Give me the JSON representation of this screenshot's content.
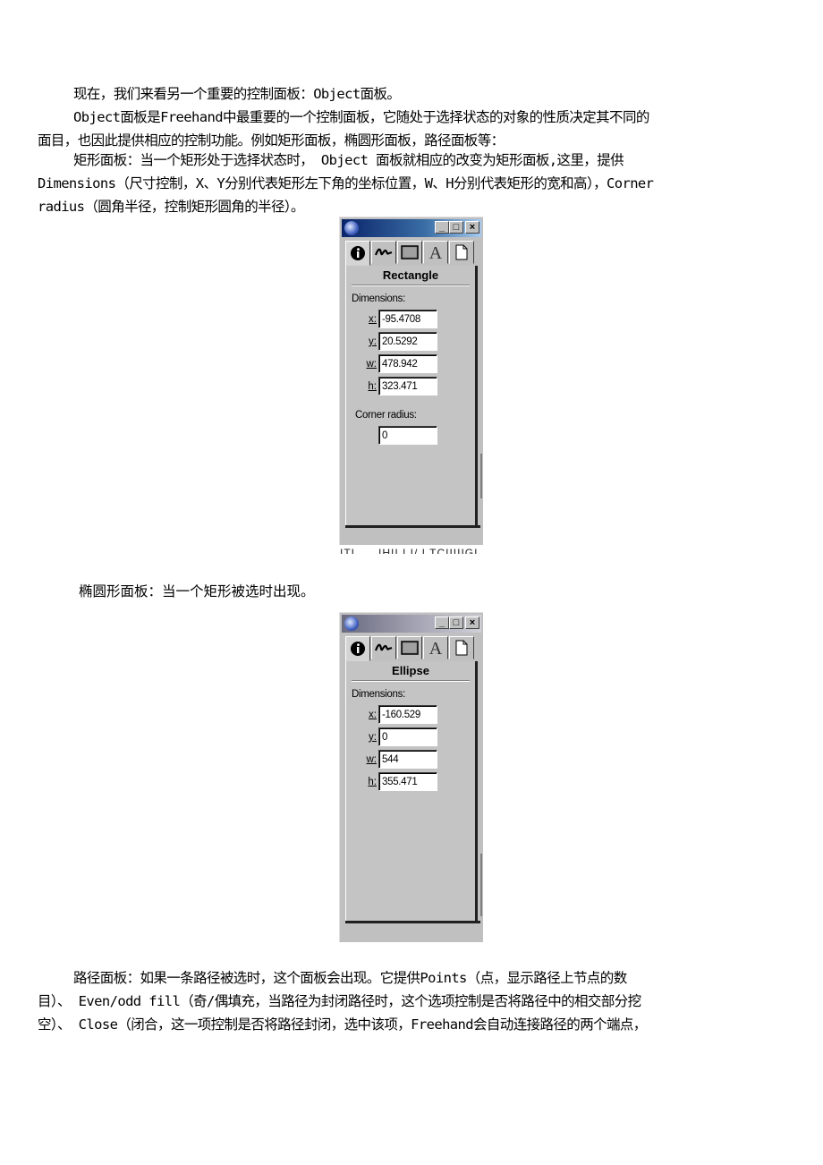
{
  "paragraphs": {
    "p1": "现在，我们来看另一个重要的控制面板：Object面板。",
    "p2_line1": "Object面板是Freehand中最重要的一个控制面板，它随处于选择状态的对象的性质决定其不同的",
    "p2_line2": "面目，也因此提供相应的控制功能。例如矩形面板，椭圆形面板，路径面板等：",
    "p3_line1": "矩形面板：当一个矩形处于选择状态时， Object 面板就相应的改变为矩形面板,这里，提供",
    "p3_line2": "Dimensions（尺寸控制，X、Y分别代表矩形左下角的坐标位置，W、H分别代表矩形的宽和高），Corner",
    "p3_line3": "radius（圆角半径，控制矩形圆角的半径）。",
    "p4": "椭圆形面板：当一个矩形被选时出现。",
    "p5_line1": "路径面板：如果一条路径被选时，这个面板会出现。它提供Points（点，显示路径上节点的数",
    "p5_line2": "目）、 Even/odd fill（奇/偶填充，当路径为封闭路径时，这个选项控制是否将路径中的相交部分挖",
    "p5_line3": "空）、 Close（闭合，这一项控制是否将路径封闭，选中该项，Freehand会自动连接路径的两个端点，"
  },
  "window_buttons": {
    "minimize": "_",
    "maximize": "□",
    "close": "×"
  },
  "tabs": [
    {
      "icon": "info-icon",
      "active": true
    },
    {
      "icon": "stroke-icon",
      "active": false
    },
    {
      "icon": "fill-icon",
      "active": false
    },
    {
      "icon": "text-icon",
      "label": "A",
      "active": false
    },
    {
      "icon": "document-icon",
      "active": false
    }
  ],
  "rectangle_panel": {
    "title": "Rectangle",
    "dimensions_label": "Dimensions:",
    "fields": [
      {
        "label": "x:",
        "value": "-95.4708"
      },
      {
        "label": "y:",
        "value": "20.5292"
      },
      {
        "label": "w:",
        "value": "478.942"
      },
      {
        "label": "h:",
        "value": "323.471"
      }
    ],
    "corner_radius_label": "Corner radius:",
    "corner_radius_value": "0"
  },
  "ellipse_panel": {
    "title": "Ellipse",
    "dimensions_label": "Dimensions:",
    "fields": [
      {
        "label": "x:",
        "value": "-160.529"
      },
      {
        "label": "y:",
        "value": "0"
      },
      {
        "label": "w:",
        "value": "544"
      },
      {
        "label": "h:",
        "value": "355.471"
      }
    ]
  }
}
